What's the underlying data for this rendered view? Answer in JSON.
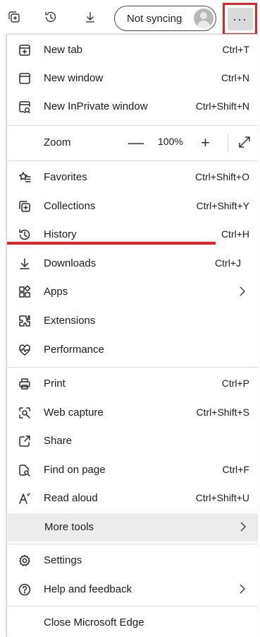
{
  "toolbar": {
    "profile_label": "Not syncing",
    "more_label": "···",
    "icons": [
      "collections-icon",
      "history-icon",
      "downloads-icon"
    ]
  },
  "menu": {
    "new_tab": {
      "label": "New tab",
      "shortcut": "Ctrl+T"
    },
    "new_window": {
      "label": "New window",
      "shortcut": "Ctrl+N"
    },
    "new_inprivate": {
      "label": "New InPrivate window",
      "shortcut": "Ctrl+Shift+N"
    },
    "zoom": {
      "label": "Zoom",
      "minus": "—",
      "value": "100%",
      "plus": "+"
    },
    "favorites": {
      "label": "Favorites",
      "shortcut": "Ctrl+Shift+O"
    },
    "collections": {
      "label": "Collections",
      "shortcut": "Ctrl+Shift+Y"
    },
    "history": {
      "label": "History",
      "shortcut": "Ctrl+H"
    },
    "downloads": {
      "label": "Downloads",
      "shortcut": "Ctrl+J"
    },
    "apps": {
      "label": "Apps"
    },
    "extensions": {
      "label": "Extensions"
    },
    "performance": {
      "label": "Performance"
    },
    "print": {
      "label": "Print",
      "shortcut": "Ctrl+P"
    },
    "web_capture": {
      "label": "Web capture",
      "shortcut": "Ctrl+Shift+S"
    },
    "share": {
      "label": "Share"
    },
    "find_on_page": {
      "label": "Find on page",
      "shortcut": "Ctrl+F"
    },
    "read_aloud": {
      "label": "Read aloud",
      "shortcut": "Ctrl+Shift+U"
    },
    "more_tools": {
      "label": "More tools"
    },
    "settings": {
      "label": "Settings"
    },
    "help_feedback": {
      "label": "Help and feedback"
    },
    "close_edge": {
      "label": "Close Microsoft Edge"
    }
  },
  "colors": {
    "annotation_red": "#e0222a",
    "hover_bg": "#ececec"
  }
}
